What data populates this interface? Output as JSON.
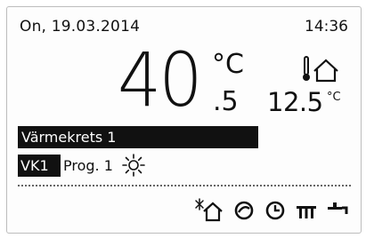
{
  "header": {
    "date": "On, 19.03.2014",
    "time": "14:36"
  },
  "room": {
    "temp_integer": "40",
    "temp_decimal": ".5",
    "temp_unit": "°C"
  },
  "outdoor": {
    "temp_value": "12.5",
    "temp_unit": "°C",
    "icon": "outdoor-thermometer-house-icon"
  },
  "circuit": {
    "name": "Värmekrets 1"
  },
  "program": {
    "circuit_code": "VK1",
    "label": "Prog. 1",
    "mode_icon": "sun-icon"
  },
  "bottom_icons": [
    "holiday-house-icon",
    "eco-mode-icon",
    "timer-clock-icon",
    "radiator-icon",
    "hot-water-tap-icon"
  ],
  "colors": {
    "background": "#fdfdfd",
    "ink": "#111111",
    "inverse_text": "#ffffff"
  }
}
